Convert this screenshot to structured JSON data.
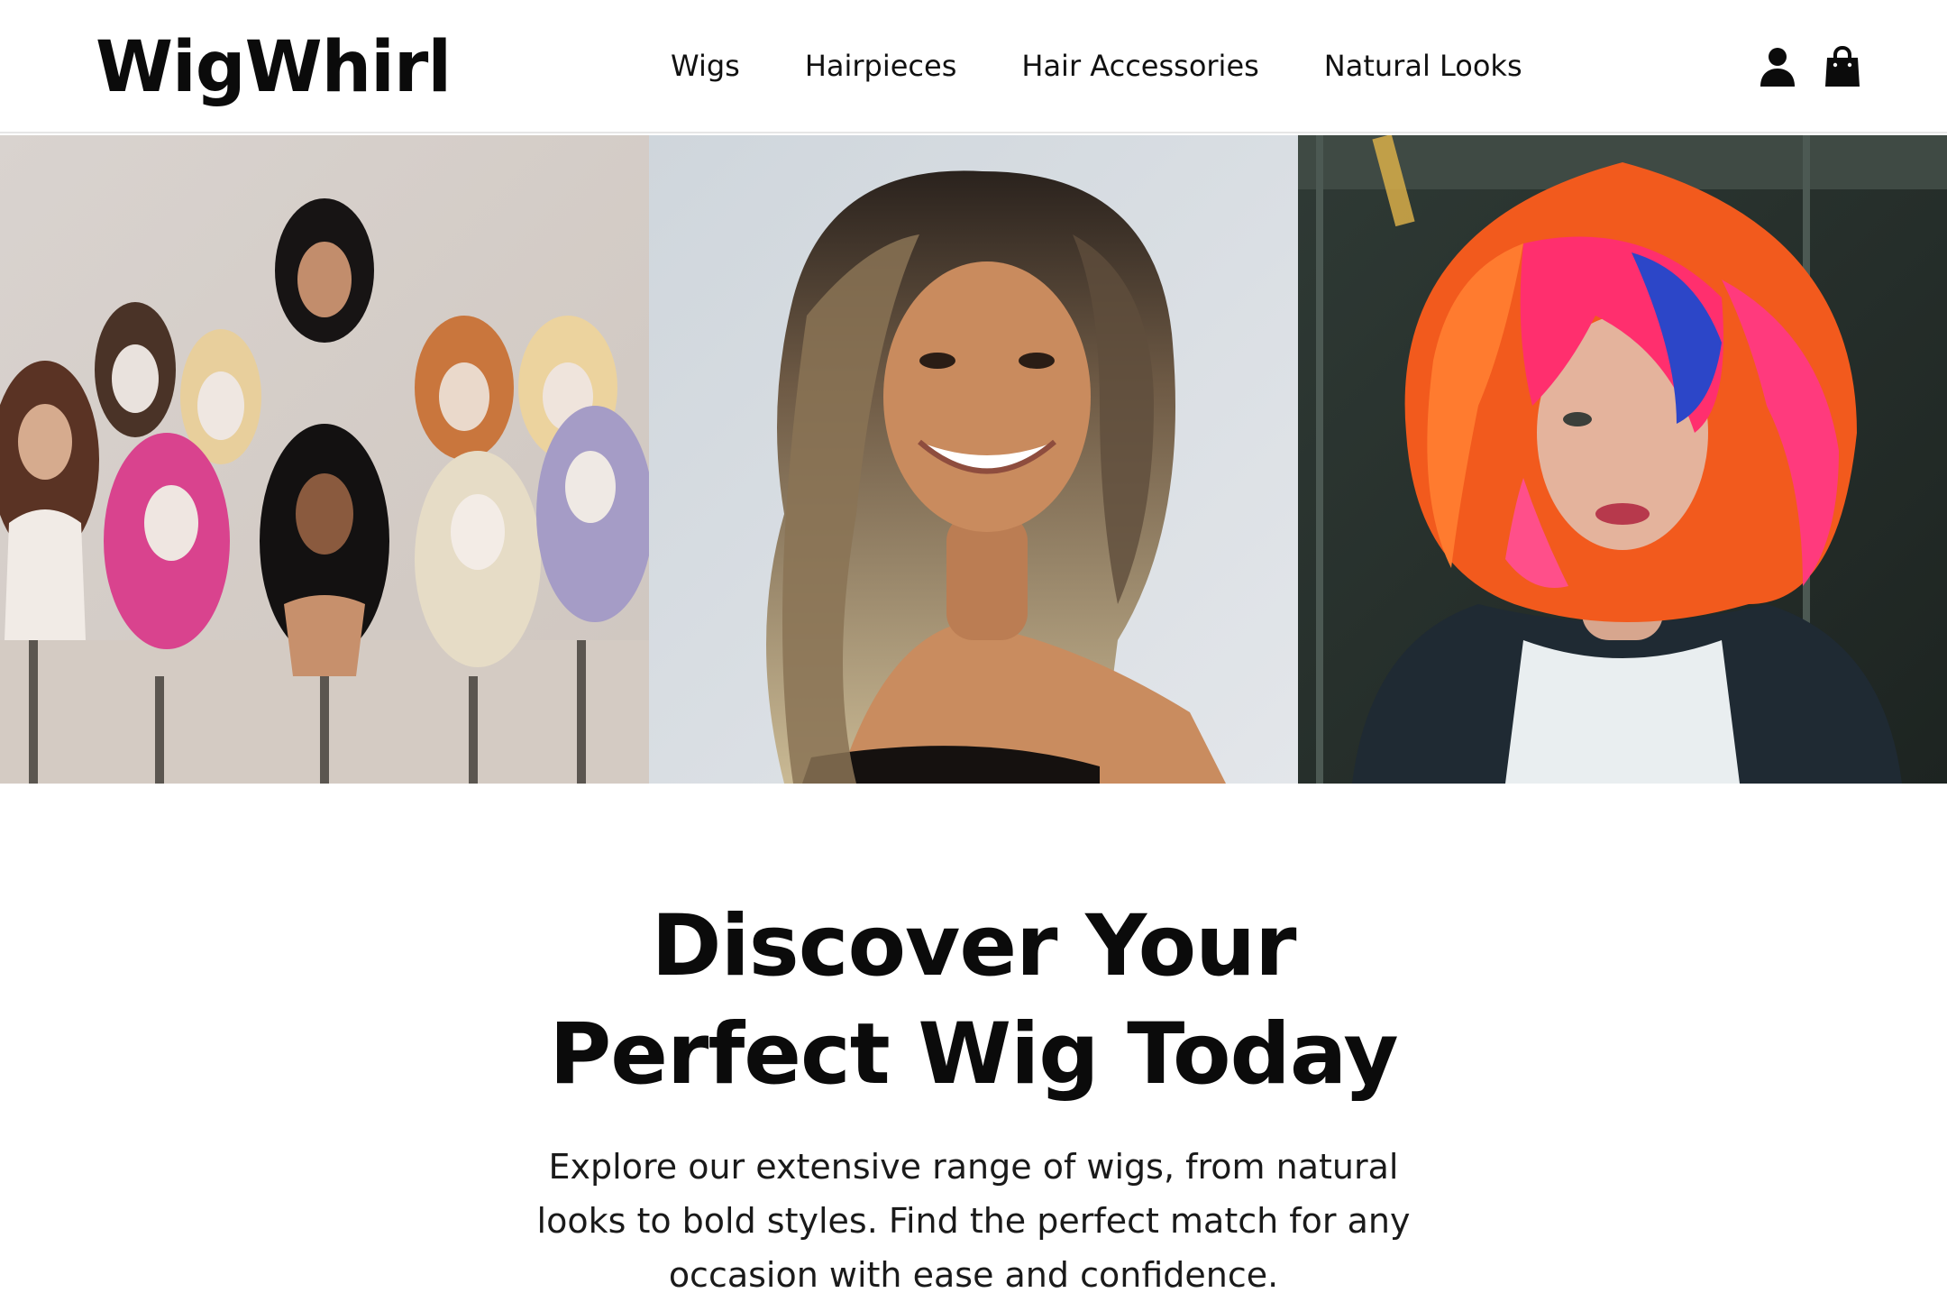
{
  "brand": {
    "name": "WigWhirl"
  },
  "nav": {
    "items": [
      {
        "label": "Wigs"
      },
      {
        "label": "Hairpieces"
      },
      {
        "label": "Hair Accessories"
      },
      {
        "label": "Natural Looks"
      }
    ]
  },
  "header_icons": [
    "user-icon",
    "shopping-bag-icon"
  ],
  "hero": {
    "panels": [
      {
        "image": "wig-display-mannequins"
      },
      {
        "image": "woman-balayage-wig"
      },
      {
        "image": "woman-colorful-wig"
      }
    ]
  },
  "headline": {
    "line1": "Discover Your",
    "line2": "Perfect Wig Today"
  },
  "description": "Explore our extensive range of wigs, from natural looks to bold styles. Find the perfect match for any occasion with ease and confidence.",
  "colors": {
    "text": "#0b0b0b",
    "background": "#ffffff",
    "divider": "#e6e6e6"
  }
}
